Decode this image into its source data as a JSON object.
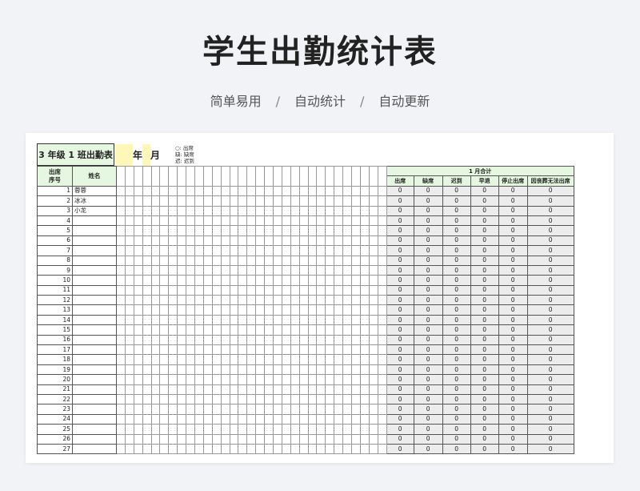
{
  "page": {
    "title": "学生出勤统计表",
    "tags": [
      "简单易用",
      "自动统计",
      "自动更新"
    ],
    "separator": "/"
  },
  "sheet": {
    "class_title": "3 年级 1 班出勤表",
    "year_label": "年",
    "month_label": "月",
    "legend": [
      "○: 出席",
      "缺: 缺席",
      "迟: 迟到"
    ],
    "col_seq_line1": "出席",
    "col_seq_line2": "序号",
    "col_name": "姓名",
    "summary_title": "1 月合计",
    "summary_cols": [
      "出席",
      "缺席",
      "迟到",
      "早退",
      "停止出席",
      "因丧葬无法出席"
    ],
    "students": [
      {
        "no": "1",
        "name": "蓉蓉"
      },
      {
        "no": "2",
        "name": "冰冰"
      },
      {
        "no": "3",
        "name": "小龙"
      },
      {
        "no": "4",
        "name": ""
      },
      {
        "no": "5",
        "name": ""
      },
      {
        "no": "6",
        "name": ""
      },
      {
        "no": "7",
        "name": ""
      },
      {
        "no": "8",
        "name": ""
      },
      {
        "no": "9",
        "name": ""
      },
      {
        "no": "10",
        "name": ""
      },
      {
        "no": "11",
        "name": ""
      },
      {
        "no": "12",
        "name": ""
      },
      {
        "no": "13",
        "name": ""
      },
      {
        "no": "14",
        "name": ""
      },
      {
        "no": "15",
        "name": ""
      },
      {
        "no": "16",
        "name": ""
      },
      {
        "no": "17",
        "name": ""
      },
      {
        "no": "18",
        "name": ""
      },
      {
        "no": "19",
        "name": ""
      },
      {
        "no": "20",
        "name": ""
      },
      {
        "no": "21",
        "name": ""
      },
      {
        "no": "22",
        "name": ""
      },
      {
        "no": "23",
        "name": ""
      },
      {
        "no": "24",
        "name": ""
      },
      {
        "no": "25",
        "name": ""
      },
      {
        "no": "26",
        "name": ""
      },
      {
        "no": "27",
        "name": ""
      }
    ],
    "summary_value": "0",
    "day_columns": 31
  }
}
